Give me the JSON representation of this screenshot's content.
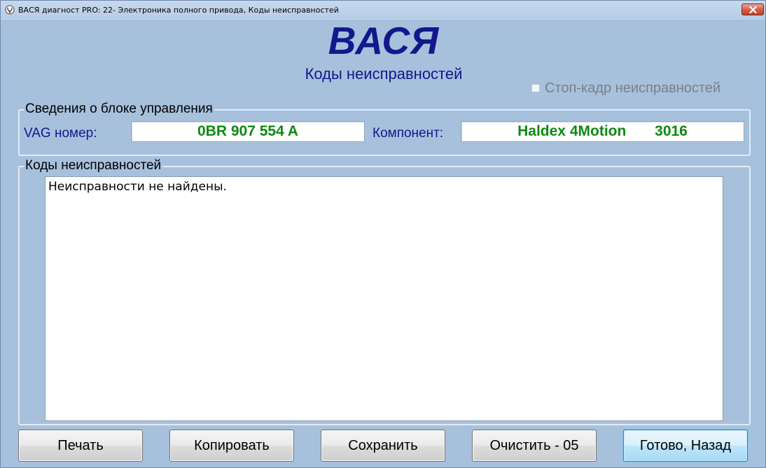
{
  "window": {
    "title": "ВАСЯ диагност PRO: 22- Электроника полного привода,  Коды неисправностей",
    "app_icon": "diagnostic-stethoscope-icon",
    "close_icon": "close-icon"
  },
  "header": {
    "logo": "ВАСЯ",
    "subtitle": "Коды неисправностей",
    "freeze_frame_label": "Стоп-кадр неисправностей",
    "freeze_frame_checked": false,
    "freeze_frame_enabled": false
  },
  "control_unit": {
    "legend": "Сведения о блоке управления",
    "vag_label": "VAG номер:",
    "vag_number": "0BR 907 554 A",
    "component_label": "Компонент:",
    "component_value": "Haldex 4Motion       3016"
  },
  "faults": {
    "legend": "Коды неисправностей",
    "text": "Неисправности не найдены."
  },
  "buttons": {
    "print": "Печать",
    "copy": "Копировать",
    "save": "Сохранить",
    "clear": "Очистить - 05",
    "done": "Готово, Назад"
  },
  "colors": {
    "background": "#a7c1dd",
    "accent_blue": "#13178c",
    "value_green": "#0d8a12",
    "disabled_text": "#7a7f86"
  }
}
